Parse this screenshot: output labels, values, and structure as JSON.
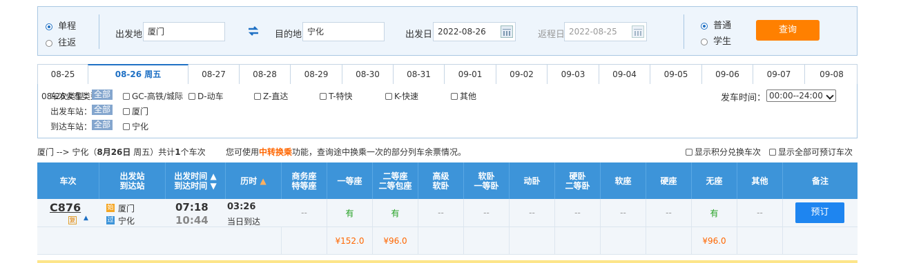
{
  "search": {
    "trip_types": [
      "单程",
      "往返"
    ],
    "from_label": "出发地",
    "from_value": "厦门",
    "swap_icon": "swap-arrows-icon",
    "to_label": "目的地",
    "to_value": "宁化",
    "depart_label": "出发日",
    "depart_value": "2022-08-26",
    "return_label": "返程日",
    "return_value": "2022-08-25",
    "passenger_types": [
      "普通",
      "学生"
    ],
    "query_button": "查询"
  },
  "date_tabs": [
    "08-25",
    "08-26 周五",
    "08-27",
    "08-28",
    "08-29",
    "08-30",
    "08-31",
    "09-01",
    "09-02",
    "09-03",
    "09-04",
    "09-05",
    "09-06",
    "09-07",
    "09-08"
  ],
  "filters": {
    "overlap_label": "08-26火车类型：",
    "train_type_label": "车次类型：",
    "all_chip": "全部",
    "train_types": [
      "GC-高铁/城际",
      "D-动车",
      "Z-直达",
      "T-特快",
      "K-快速",
      "其他"
    ],
    "depart_station_label": "出发车站：",
    "depart_stations": [
      "厦门"
    ],
    "arrive_station_label": "到达车站：",
    "arrive_stations": [
      "宁化"
    ],
    "time_label": "发车时间：",
    "time_value": "00:00--24:00"
  },
  "summary": {
    "route": "厦门 --> 宁化（",
    "date": "8月26日",
    "weekday": " 周五）共计",
    "count": "1",
    "count_suffix": "个车次",
    "tip_prefix": "您可使用",
    "tip_link": "中转换乘",
    "tip_suffix": "功能，查询途中换乘一次的部分列车余票情况。",
    "option_points": "显示积分兑换车次",
    "option_all": "显示全部可预订车次"
  },
  "table": {
    "headers": [
      [
        "车次"
      ],
      [
        "出发站",
        "到达站"
      ],
      [
        "出发时间",
        "到达时间"
      ],
      [
        "历时"
      ],
      [
        "商务座",
        "特等座"
      ],
      [
        "一等座"
      ],
      [
        "二等座",
        "二等包座"
      ],
      [
        "高级",
        "软卧"
      ],
      [
        "软卧",
        "一等卧"
      ],
      [
        "动卧"
      ],
      [
        "硬卧",
        "二等卧"
      ],
      [
        "软座"
      ],
      [
        "硬座"
      ],
      [
        "无座"
      ],
      [
        "其他"
      ],
      [
        "备注"
      ]
    ],
    "row": {
      "train_no": "C876",
      "fu_tag": "复",
      "from_tag": "始",
      "to_tag": "过",
      "from_station": "厦门",
      "to_station": "宁化",
      "depart_time": "07:18",
      "arrive_time": "10:44",
      "duration": "03:26",
      "arrive_day": "当日到达",
      "seats": [
        "--",
        "有",
        "有",
        "--",
        "--",
        "--",
        "--",
        "--",
        "--",
        "有",
        "--"
      ],
      "book_button": "预订"
    },
    "prices": {
      "first": "¥152.0",
      "second": "¥96.0",
      "no_seat": "¥96.0"
    }
  },
  "colors": {
    "accent": "#1e70c4",
    "header": "#3d94d9",
    "orange": "#ff8000",
    "green": "#22a020"
  }
}
